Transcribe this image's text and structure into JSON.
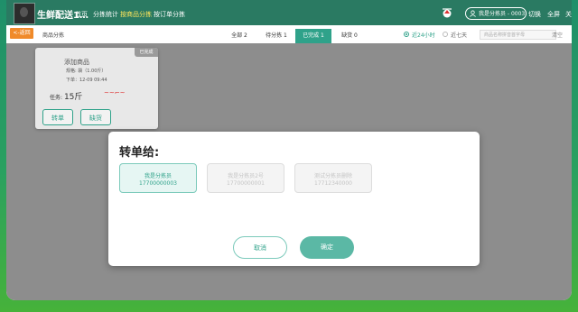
{
  "topbar": {
    "brand": "生鲜配送1…",
    "nav": [
      {
        "label": "首页"
      },
      {
        "label": "分拣统计"
      },
      {
        "label": "按商品分拣"
      },
      {
        "label": "按订单分拣"
      }
    ],
    "user_label": "我是分拣员 - 0003",
    "switch_label": "切换",
    "fullscreen_label": "全屏",
    "close_label": "关",
    "accent_color": "#ffe55c"
  },
  "subbar": {
    "back_label": "<-返回",
    "breadcrumb": "商品分拣",
    "tabs": [
      {
        "label": "全部 2"
      },
      {
        "label": "待分拣 1"
      },
      {
        "label": "已完成 1"
      },
      {
        "label": "缺货 0"
      }
    ],
    "active_tab": "已完成 1",
    "range_options": [
      {
        "label": "近24小时",
        "selected": true
      },
      {
        "label": "近七天",
        "selected": false
      }
    ],
    "search_placeholder": "商品名称拼音首字母",
    "search_button": "清空"
  },
  "card": {
    "tag": "已完成",
    "title": "添加商品",
    "spec": "规格: 袋（1.00斤）",
    "time": "下单：12-09 09:44",
    "task_label": "任务:",
    "task_value": "15斤",
    "buttons": [
      {
        "label": "转单"
      },
      {
        "label": "缺货"
      }
    ]
  },
  "modal": {
    "title": "转单给:",
    "sorters": [
      {
        "name": "我是分拣员",
        "phone": "17700000003",
        "selected": true
      },
      {
        "name": "我是分拣员2号",
        "phone": "17700000001",
        "selected": false
      },
      {
        "name": "测试分拣员删除",
        "phone": "17712340000",
        "selected": false
      }
    ],
    "cancel_label": "取消",
    "confirm_label": "确定",
    "primary_color": "#5bb8a5"
  }
}
